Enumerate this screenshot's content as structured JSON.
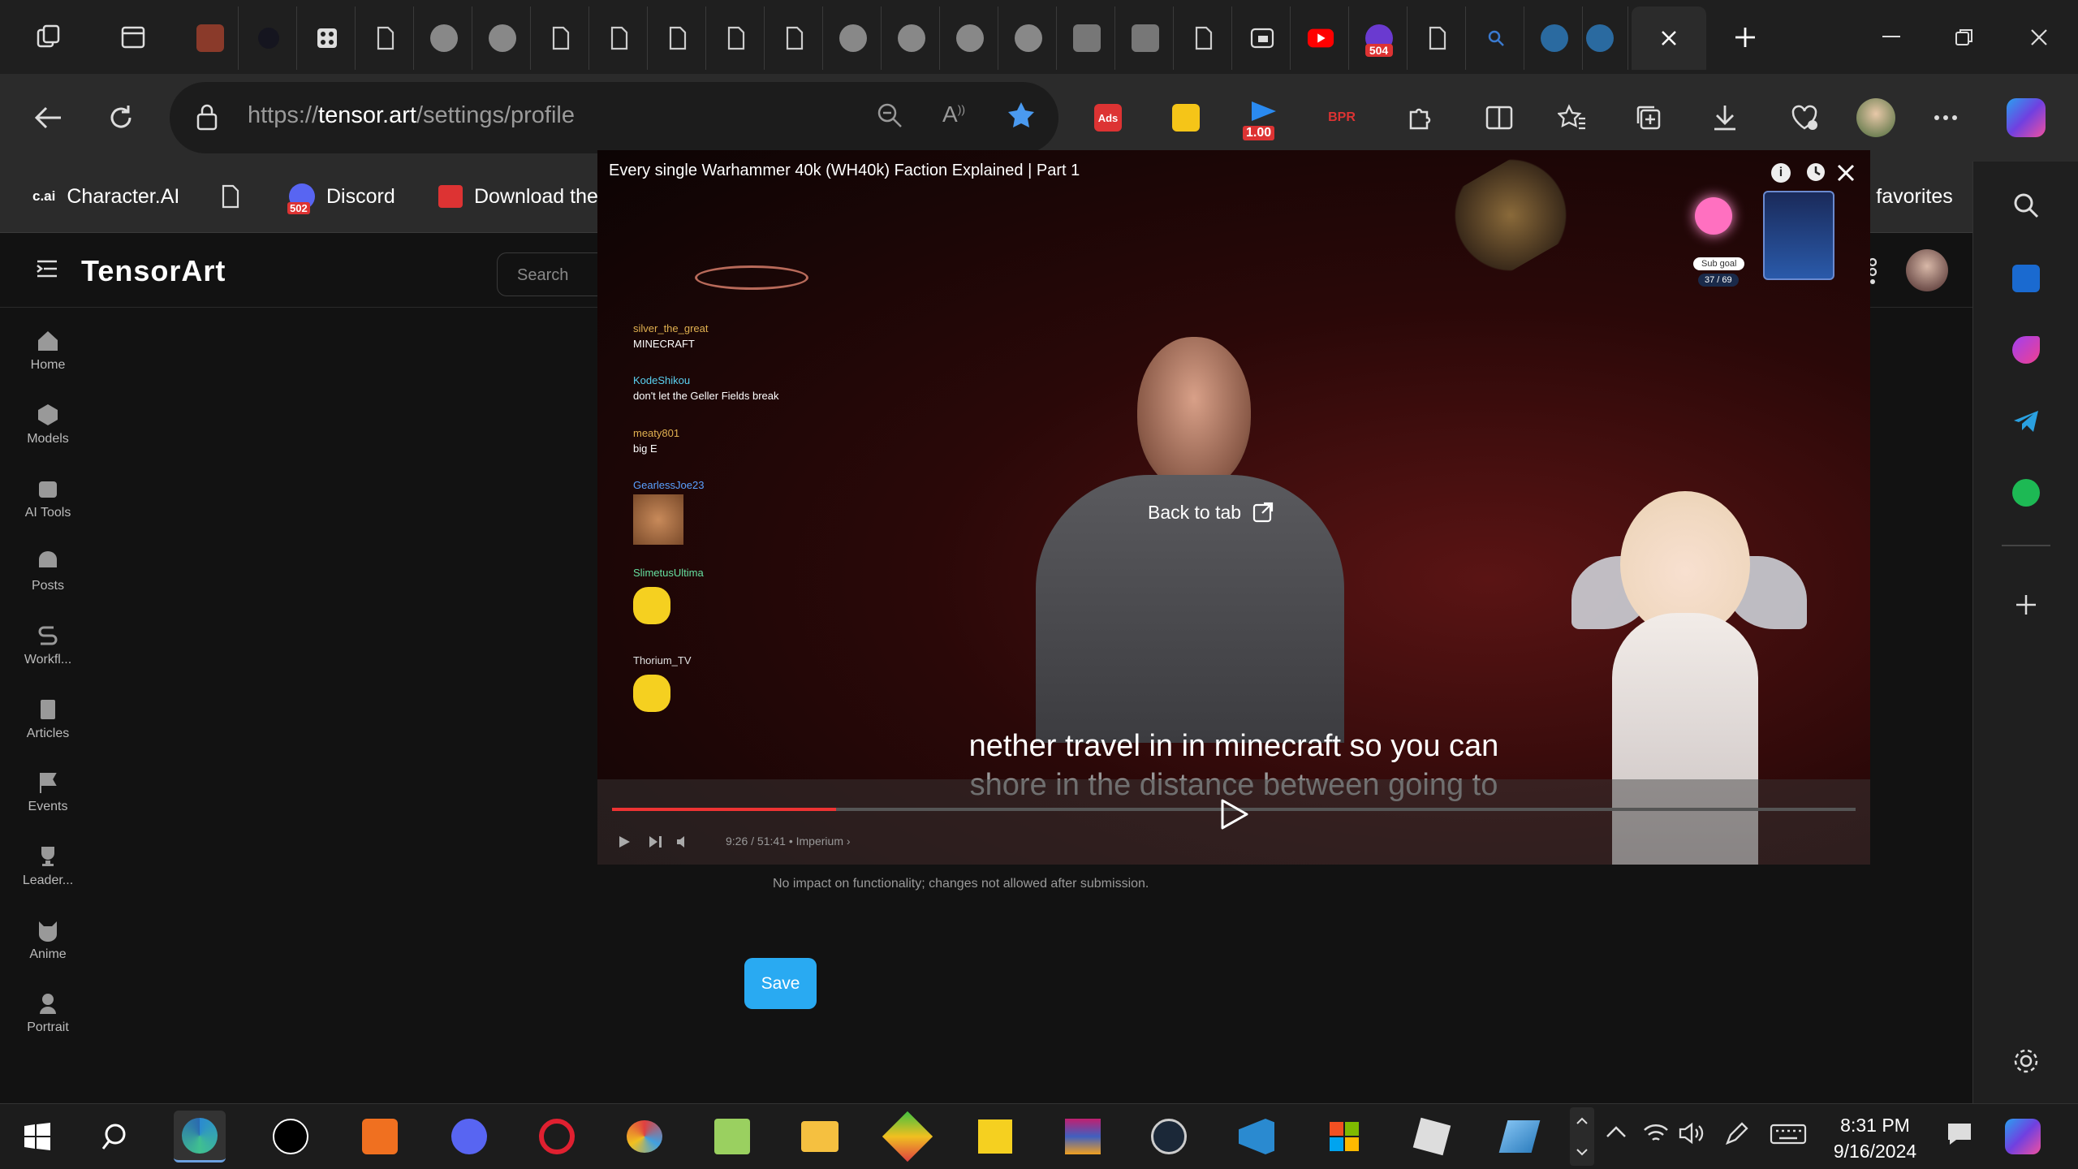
{
  "browser": {
    "url_prefix": "https://",
    "url_host": "tensor.art",
    "url_path": "/settings/profile",
    "extension_badge": "1.00",
    "tab_badges": {
      "discord": "502",
      "reddit": "504"
    }
  },
  "favorites": {
    "items": [
      {
        "label": "Character.AI",
        "icon": "cai-icon"
      },
      {
        "label": "",
        "icon": "page-icon"
      },
      {
        "label": "Discord",
        "icon": "discord-icon",
        "badge": "502"
      },
      {
        "label": "Download the",
        "icon": "calendar-icon"
      }
    ],
    "other_label": "r favorites"
  },
  "tensorart": {
    "logo": "TensorArt",
    "search_placeholder": "Search",
    "nav": [
      {
        "label": "Home",
        "icon": "home-icon"
      },
      {
        "label": "Models",
        "icon": "cube-icon"
      },
      {
        "label": "AI Tools",
        "icon": "robot-icon"
      },
      {
        "label": "Posts",
        "icon": "image-icon"
      },
      {
        "label": "Workfl...",
        "icon": "workflow-icon"
      },
      {
        "label": "Articles",
        "icon": "article-icon"
      },
      {
        "label": "Events",
        "icon": "flag-icon"
      },
      {
        "label": "Leader...",
        "icon": "trophy-icon"
      },
      {
        "label": "Anime",
        "icon": "cat-icon"
      },
      {
        "label": "Portrait",
        "icon": "person-icon"
      }
    ],
    "age_note": "No impact on functionality; changes not allowed after submission.",
    "save_label": "Save"
  },
  "pip": {
    "title": "Every single Warhammer 40k (WH40k) Faction Explained | Part 1",
    "back_to_tab": "Back to tab",
    "subtitle_line1": "nether travel in in minecraft so you can",
    "subtitle_line2": "shore in the distance between going to",
    "time": "9:26 / 51:41 • Imperium ›",
    "progress": 0.18,
    "sub_goal_label": "Sub goal",
    "sub_goal_value": "37 / 69",
    "chat": [
      {
        "user": "silver_the_great",
        "message": "MINECRAFT",
        "color": "#e0b050"
      },
      {
        "user": "KodeShikou",
        "message": "don't let the Geller Fields break",
        "color": "#5ad0f0"
      },
      {
        "user": "meaty801",
        "message": "big E",
        "color": "#e0b050"
      },
      {
        "user": "GearlessJoe23",
        "message": "",
        "color": "#5aa0ff"
      },
      {
        "user": "SlimetusUltima",
        "message": "",
        "color": "#66e0a0"
      },
      {
        "user": "Thorium_TV",
        "message": "",
        "color": "#e0e0e0"
      }
    ]
  },
  "taskbar": {
    "time": "8:31 PM",
    "date": "9/16/2024"
  },
  "colors": {
    "accent": "#29aaf2",
    "tab_bg": "#1f1f1f",
    "toolbar_bg": "#2b2b2b"
  }
}
